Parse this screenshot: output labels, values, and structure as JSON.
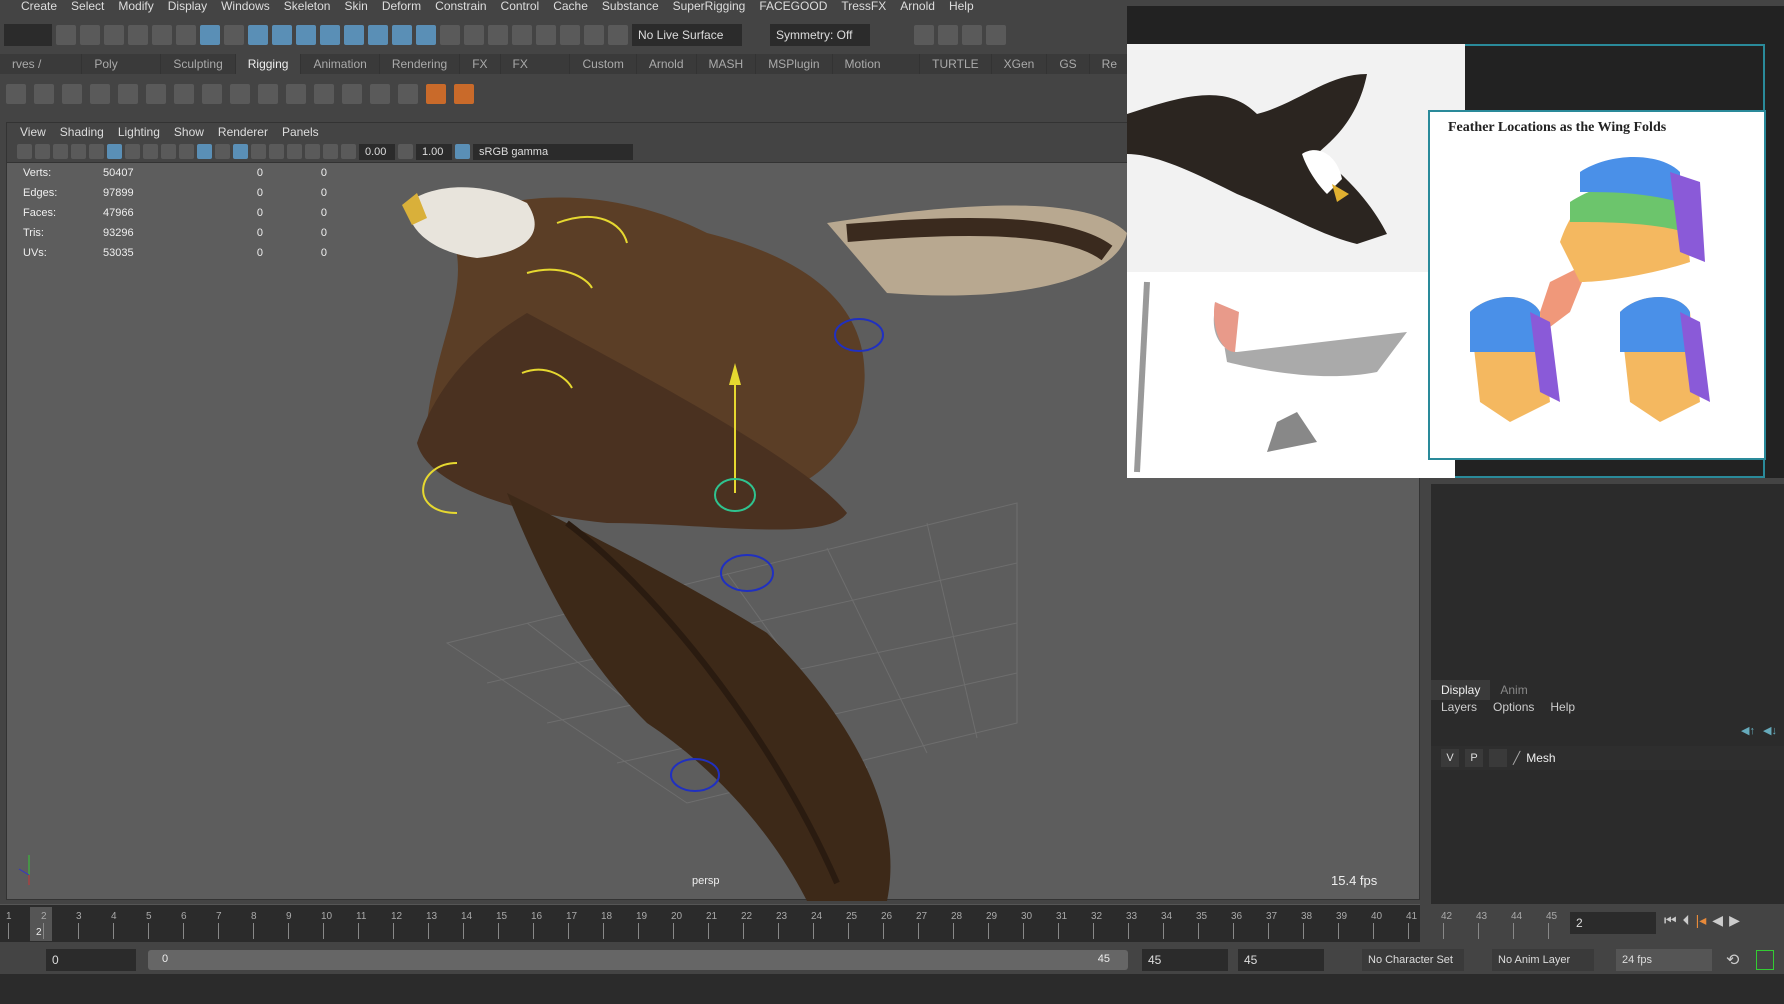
{
  "menu": [
    "Create",
    "Select",
    "Modify",
    "Display",
    "Windows",
    "Skeleton",
    "Skin",
    "Deform",
    "Constrain",
    "Control",
    "Cache",
    "Substance",
    "SuperRigging",
    "FACEGOOD",
    "TressFX",
    "Arnold",
    "Help"
  ],
  "status": {
    "live_surface": "No Live Surface",
    "symmetry": "Symmetry: Off"
  },
  "shelf_tabs": [
    "rves / Surfaces",
    "Poly Modeling",
    "Sculpting",
    "Rigging",
    "Animation",
    "Rendering",
    "FX",
    "FX Caching",
    "Custom",
    "Arnold",
    "MASH",
    "MSPlugin",
    "Motion Graphics",
    "TURTLE",
    "XGen",
    "GS",
    "Re"
  ],
  "active_shelf": "Rigging",
  "panel_menu": [
    "View",
    "Shading",
    "Lighting",
    "Show",
    "Renderer",
    "Panels"
  ],
  "panel_toolbar": {
    "exposure": "0.00",
    "gamma": "1.00",
    "color_space": "sRGB gamma"
  },
  "stats": [
    {
      "label": "Verts:",
      "v": "50407",
      "a": "0",
      "b": "0"
    },
    {
      "label": "Edges:",
      "v": "97899",
      "a": "0",
      "b": "0"
    },
    {
      "label": "Faces:",
      "v": "47966",
      "a": "0",
      "b": "0"
    },
    {
      "label": "Tris:",
      "v": "93296",
      "a": "0",
      "b": "0"
    },
    {
      "label": "UVs:",
      "v": "53035",
      "a": "0",
      "b": "0"
    }
  ],
  "viewport": {
    "camera": "persp",
    "fps": "15.4 fps"
  },
  "reference": {
    "title": "Feather Locations as the Wing Folds"
  },
  "layer_editor": {
    "tabs": [
      "Display",
      "Anim"
    ],
    "menu": [
      "Layers",
      "Options",
      "Help"
    ],
    "layer": {
      "v": "V",
      "p": "P",
      "name": "Mesh"
    }
  },
  "timeline": {
    "ticks": [
      "1",
      "2",
      "3",
      "4",
      "5",
      "6",
      "7",
      "8",
      "9",
      "10",
      "11",
      "12",
      "13",
      "14",
      "15",
      "16",
      "17",
      "18",
      "19",
      "20",
      "21",
      "22",
      "23",
      "24",
      "25",
      "26",
      "27",
      "28",
      "29",
      "30",
      "31",
      "32",
      "33",
      "34",
      "35",
      "36",
      "37",
      "38",
      "39",
      "40",
      "41",
      "42",
      "43",
      "44",
      "45"
    ],
    "current_frame": "2",
    "current_field": "2"
  },
  "range": {
    "start": "0",
    "slider_start": "0",
    "slider_end": "45",
    "end": "45",
    "end2": "45",
    "character_set": "No Character Set",
    "anim_layer": "No Anim Layer",
    "fps": "24 fps"
  }
}
